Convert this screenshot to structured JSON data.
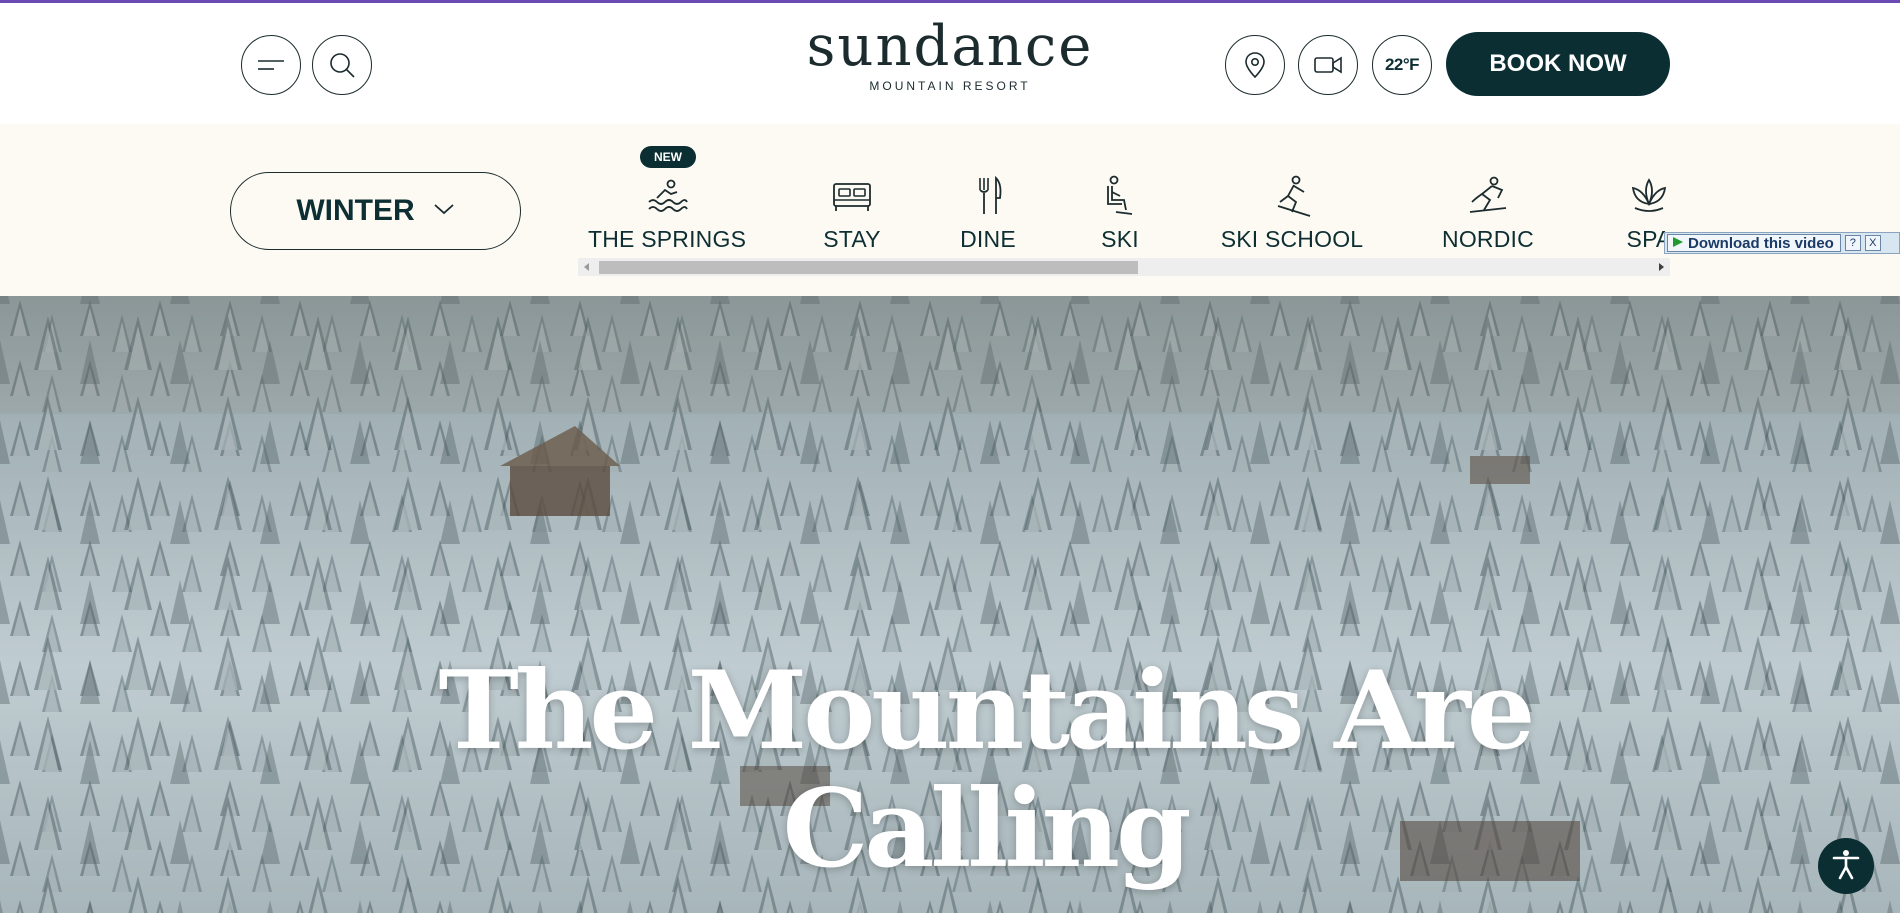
{
  "header": {
    "logo_main": "sundance",
    "logo_sub": "MOUNTAIN RESORT",
    "temperature": "22°F",
    "book_label": "BOOK NOW",
    "icons": [
      "menu-icon",
      "search-icon",
      "location-pin-icon",
      "video-camera-icon"
    ]
  },
  "nav": {
    "season_label": "WINTER",
    "new_badge": "NEW",
    "items": [
      {
        "label": "THE SPRINGS",
        "icon": "swimmer-icon"
      },
      {
        "label": "STAY",
        "icon": "bed-icon"
      },
      {
        "label": "DINE",
        "icon": "fork-knife-icon"
      },
      {
        "label": "SKI",
        "icon": "chairlift-icon"
      },
      {
        "label": "SKI SCHOOL",
        "icon": "ski-instructor-icon"
      },
      {
        "label": "NORDIC",
        "icon": "nordic-skier-icon"
      },
      {
        "label": "SPA",
        "icon": "lotus-icon"
      }
    ]
  },
  "download_bar": {
    "label": "Download this video",
    "help": "?",
    "close": "X"
  },
  "hero": {
    "title_line1": "The Mountains Are",
    "title_line2": "Calling"
  },
  "colors": {
    "brand_dark": "#0b2e33",
    "nav_background": "#fdfaf3",
    "top_accent": "#6a4bb3"
  }
}
